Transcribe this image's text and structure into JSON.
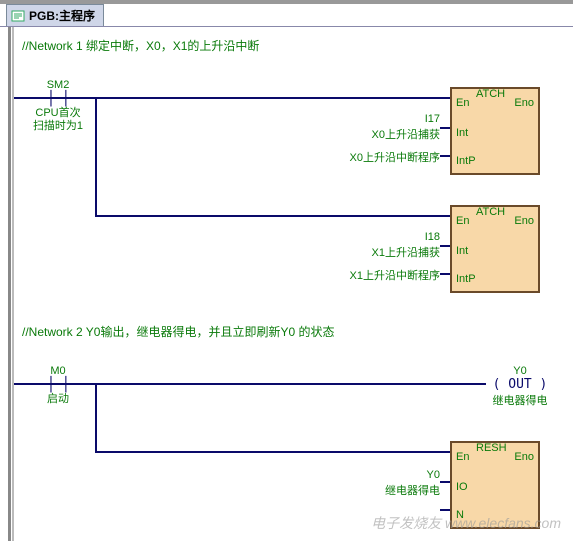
{
  "tab": {
    "title": "PGB:主程序"
  },
  "network1": {
    "comment": "//Network 1 绑定中断，X0，X1的上升沿中断",
    "contact1": {
      "tag": "SM2",
      "desc1": "CPU首次",
      "desc2": "扫描时为1"
    },
    "block1": {
      "name": "ATCH",
      "pin_en": "En",
      "pin_eno": "Eno",
      "pin_int": "Int",
      "pin_intp": "IntP",
      "int_tag": "I17",
      "int_desc": "X0上升沿捕获",
      "intp_desc": "X0上升沿中断程序"
    },
    "block2": {
      "name": "ATCH",
      "pin_en": "En",
      "pin_eno": "Eno",
      "pin_int": "Int",
      "pin_intp": "IntP",
      "int_tag": "I18",
      "int_desc": "X1上升沿捕获",
      "intp_desc": "X1上升沿中断程序"
    }
  },
  "network2": {
    "comment": "//Network 2 Y0输出，继电器得电，并且立即刷新Y0 的状态",
    "contact1": {
      "tag": "M0",
      "desc1": "启动"
    },
    "coil1": {
      "tag": "Y0",
      "sym": "( OUT )",
      "desc": "继电器得电"
    },
    "block1": {
      "name": "RESH",
      "pin_en": "En",
      "pin_eno": "Eno",
      "pin_io": "IO",
      "pin_n": "N",
      "io_tag": "Y0",
      "io_desc": "继电器得电"
    }
  },
  "watermark": "电子发烧友 www.elecfans.com"
}
